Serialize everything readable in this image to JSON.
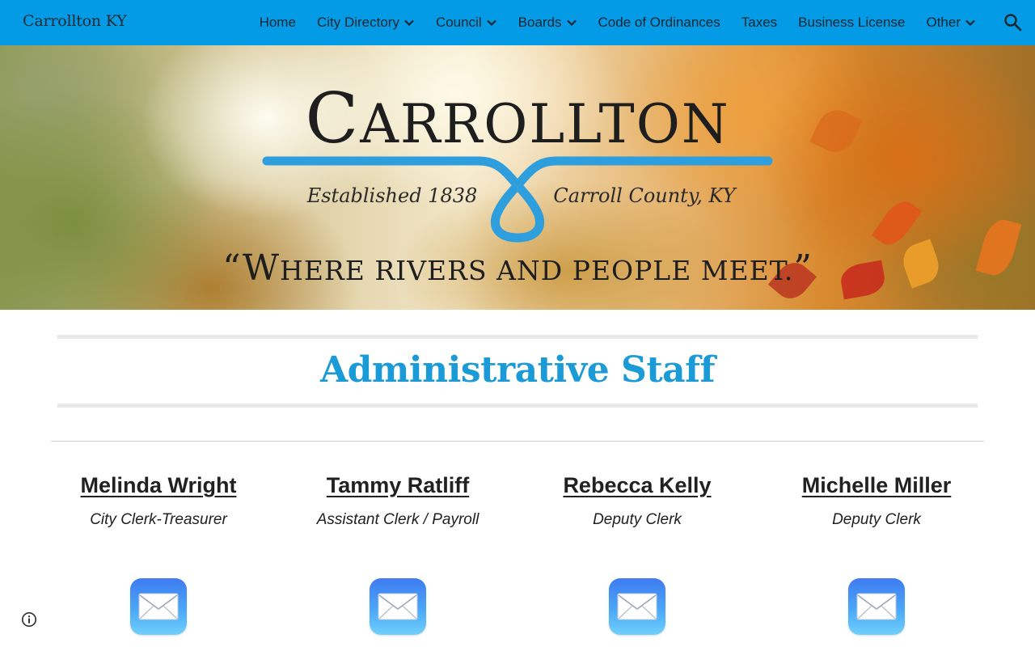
{
  "header": {
    "site_title": "Carrollton KY",
    "nav": [
      {
        "label": "Home",
        "has_menu": false
      },
      {
        "label": "City Directory",
        "has_menu": true
      },
      {
        "label": "Council",
        "has_menu": true
      },
      {
        "label": "Boards",
        "has_menu": true
      },
      {
        "label": "Code of Ordinances",
        "has_menu": false
      },
      {
        "label": "Taxes",
        "has_menu": false
      },
      {
        "label": "Business License",
        "has_menu": false
      },
      {
        "label": "Other",
        "has_menu": true
      }
    ],
    "search_icon": "search-icon",
    "bar_color": "#039be5"
  },
  "hero": {
    "logo": {
      "wordmark": "Carrollton",
      "established": "Established 1838",
      "county": "Carroll County, KY",
      "tagline": "“Where rivers and people meet.”",
      "accent_color": "#2e9fdc"
    }
  },
  "main": {
    "title": "Administrative Staff",
    "title_color": "#1a9ad6",
    "staff": [
      {
        "name": "Melinda Wright",
        "role": "City Clerk-Treasurer",
        "icon": "mail-icon"
      },
      {
        "name": "Tammy Ratliff",
        "role": "Assistant Clerk / Payroll",
        "icon": "mail-icon"
      },
      {
        "name": "Rebecca Kelly",
        "role": "Deputy Clerk",
        "icon": "mail-icon"
      },
      {
        "name": "Michelle Miller",
        "role": "Deputy Clerk",
        "icon": "mail-icon"
      }
    ]
  },
  "footer": {
    "info_icon": "info-icon"
  }
}
